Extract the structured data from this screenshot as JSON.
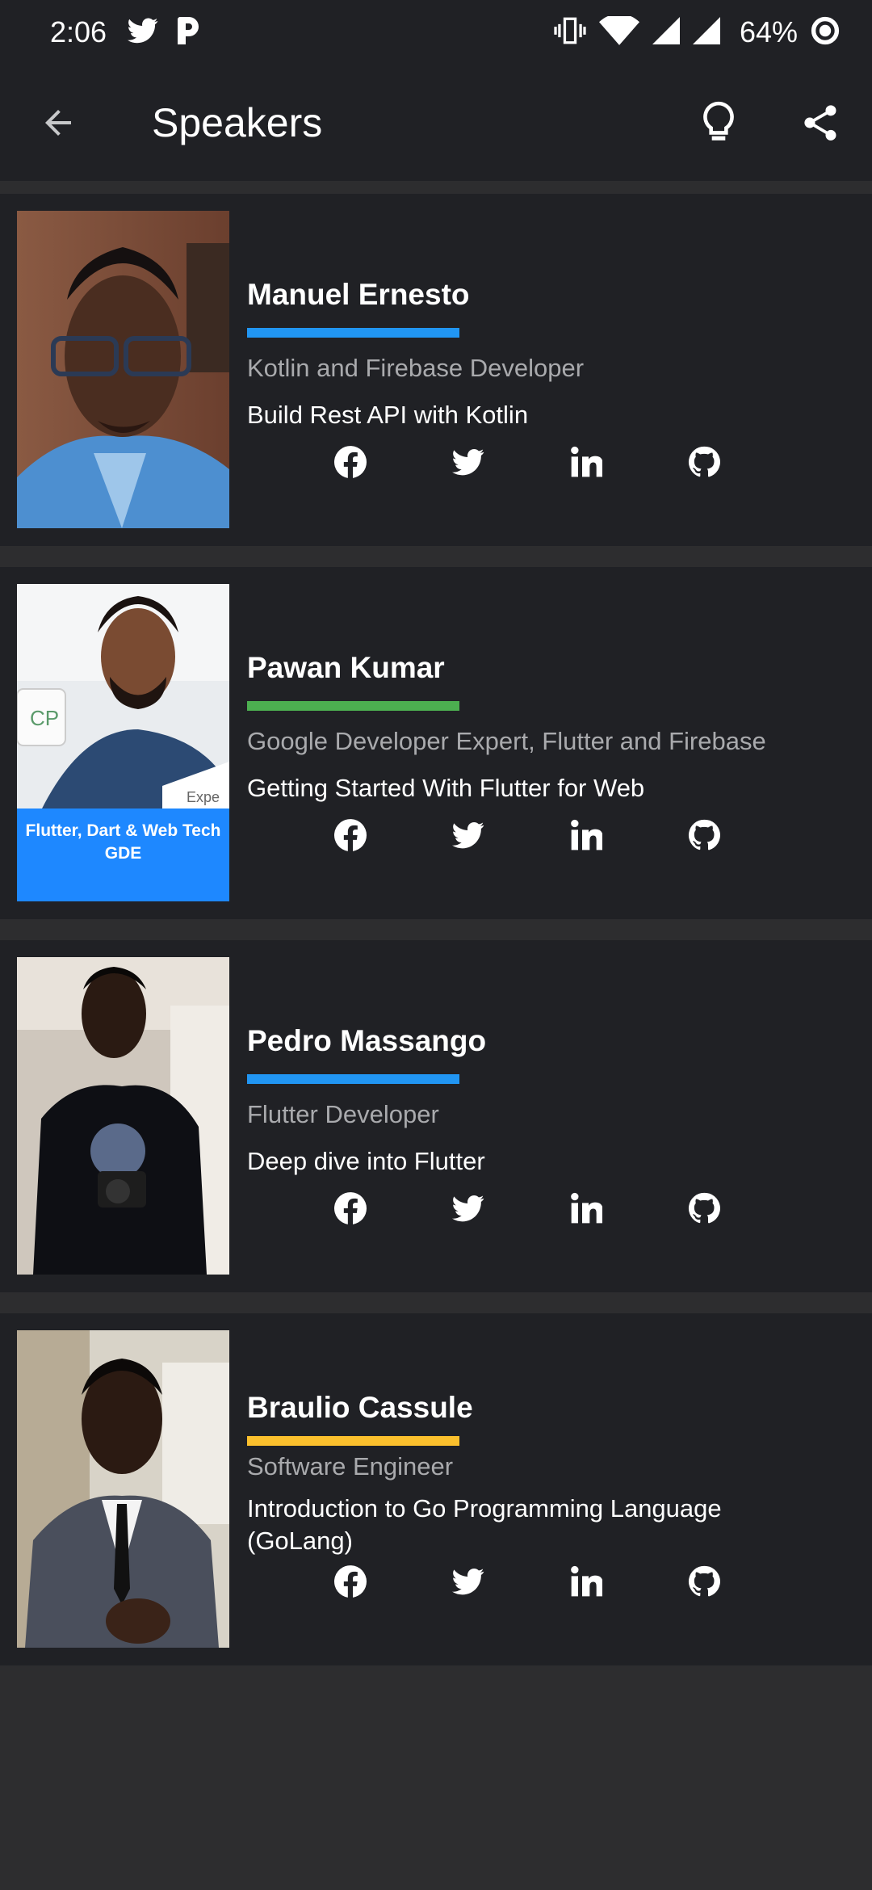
{
  "status_bar": {
    "time": "2:06",
    "battery_percent": "64%",
    "left_icons": [
      "twitter-icon",
      "p-app-icon"
    ],
    "right_icons": [
      "vibrate-icon",
      "wifi-icon",
      "signal-icon",
      "signal-icon",
      "battery-icon"
    ]
  },
  "app_bar": {
    "title": "Speakers",
    "back_icon": "arrow-left-icon",
    "actions": [
      "lightbulb-icon",
      "share-icon"
    ]
  },
  "speakers": [
    {
      "name": "Manuel Ernesto",
      "role": "Kotlin and Firebase Developer",
      "talk": "Build Rest API with Kotlin",
      "accent_color": "#2196f3",
      "socials": [
        "facebook-icon",
        "twitter-icon",
        "linkedin-icon",
        "github-icon"
      ]
    },
    {
      "name": "Pawan Kumar",
      "role": "Google Developer Expert, Flutter and Firebase",
      "talk": "Getting Started With Flutter for Web",
      "accent_color": "#4caf50",
      "photo_banner_text": "Flutter, Dart & Web Tech GDE",
      "photo_badge_text": "Expe",
      "socials": [
        "facebook-icon",
        "twitter-icon",
        "linkedin-icon",
        "github-icon"
      ]
    },
    {
      "name": "Pedro Massango",
      "role": "Flutter Developer",
      "talk": "Deep dive into Flutter",
      "accent_color": "#2196f3",
      "socials": [
        "facebook-icon",
        "twitter-icon",
        "linkedin-icon",
        "github-icon"
      ]
    },
    {
      "name": "Braulio Cassule",
      "role": "Software Engineer",
      "talk": "Introduction to Go Programming Language (GoLang)",
      "accent_color": "#fbc02d",
      "socials": [
        "facebook-icon",
        "twitter-icon",
        "linkedin-icon",
        "github-icon"
      ]
    }
  ],
  "colors": {
    "surface": "#202125",
    "background": "#2d2d2f",
    "secondary_text": "#a9aaad"
  }
}
